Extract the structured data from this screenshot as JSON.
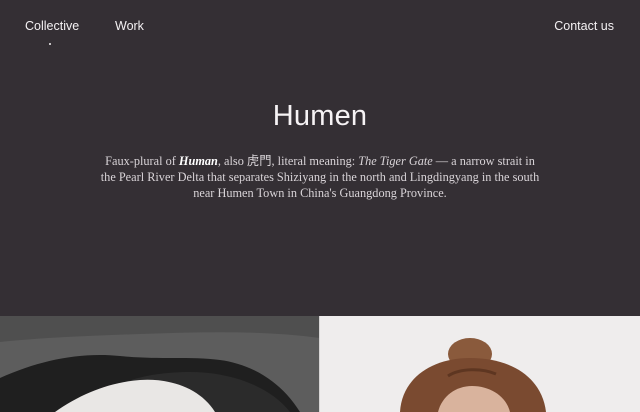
{
  "nav": {
    "left": [
      {
        "label": "Collective"
      },
      {
        "label": "Work"
      }
    ],
    "contact_label": "Contact us"
  },
  "hero": {
    "title": "Humen",
    "desc": {
      "prefix": "Faux-plural of ",
      "emphasis": "Human",
      "also": ", also ",
      "chinese": "虎門",
      "meaning_prefix": ", literal meaning: ",
      "meaning": "The Tiger Gate",
      "rest": " — a narrow strait in the Pearl River Delta that separates Shiziyang in the north and Lingdingyang in the south near Humen Town in China's Guangdong Province."
    }
  },
  "gallery": {
    "left_photo_icon": "portrait-photo-icon",
    "right_photo_icon": "portrait-photo-icon"
  },
  "colors": {
    "background": "#342f34",
    "text": "#f4f1f3",
    "body_text": "#d9d4d8"
  }
}
